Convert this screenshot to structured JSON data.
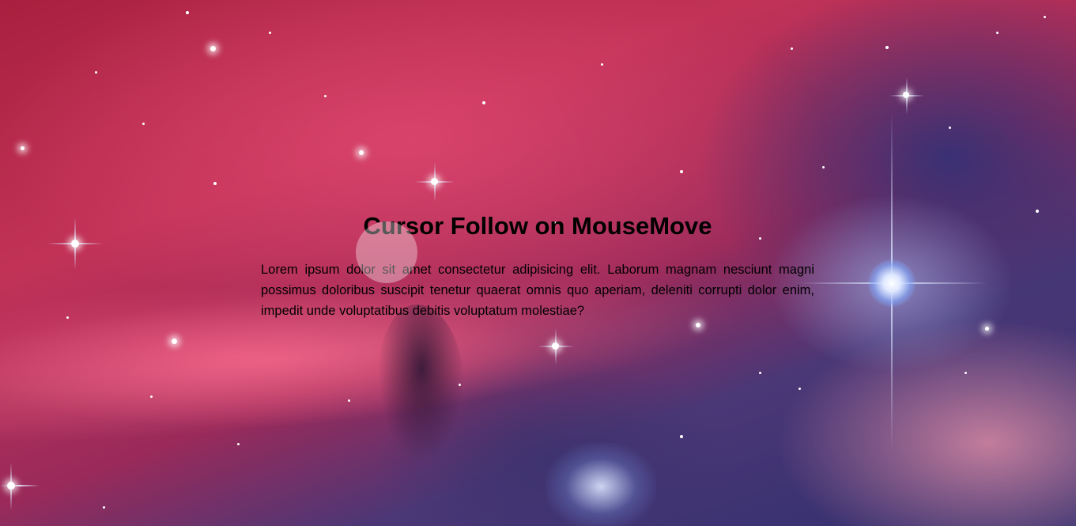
{
  "page": {
    "title": "Cursor Follow on MouseMove",
    "paragraph": "Lorem ipsum dolor sit amet consectetur adipisicing elit. Laborum magnam nesciunt magni possimus doloribus suscipit tenetur quaerat omnis quo aperiam, deleniti corrupti dolor enim, impedit unde voluptatibus debitis voluptatum molestiae?"
  },
  "background": {
    "image": "space-nebula-background",
    "accent_colors": [
      "#c23257",
      "#4b3776",
      "#2f2f6e"
    ]
  },
  "cursor": {
    "icon": "cursor-follower-circle",
    "color": "#ffffff"
  }
}
